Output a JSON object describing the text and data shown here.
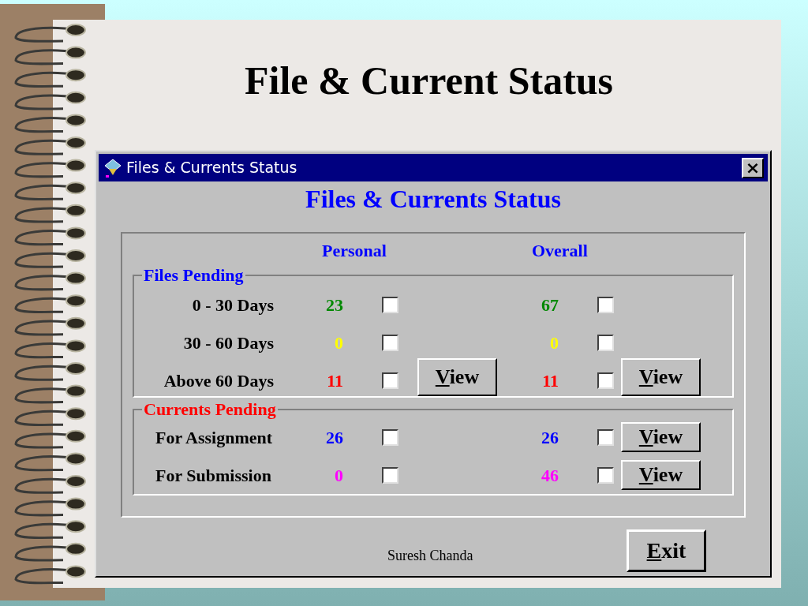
{
  "slide": {
    "title": "File & Current Status",
    "footer": "Suresh Chanda"
  },
  "window": {
    "title": "Files & Currents Status",
    "close": "×",
    "heading": "Files & Currents Status"
  },
  "columns": {
    "personal": "Personal",
    "overall": "Overall"
  },
  "files_pending": {
    "title": "Files Pending",
    "rows": [
      {
        "label": "0 - 30 Days",
        "personal": {
          "value": "23",
          "color": "#008800",
          "checked": false
        },
        "overall": {
          "value": "67",
          "color": "#008800",
          "checked": false
        }
      },
      {
        "label": "30 - 60 Days",
        "personal": {
          "value": "0",
          "color": "#ffff00",
          "checked": false
        },
        "overall": {
          "value": "0",
          "color": "#ffff00",
          "checked": false
        }
      },
      {
        "label": "Above 60 Days",
        "personal": {
          "value": "11",
          "color": "#ff0000",
          "checked": false
        },
        "overall": {
          "value": "11",
          "color": "#ff0000",
          "checked": false
        }
      }
    ],
    "personal_button": "View",
    "overall_button": "View"
  },
  "currents_pending": {
    "title": "Currents Pending",
    "rows": [
      {
        "label": "For Assignment",
        "personal": {
          "value": "26",
          "color": "#0000ff",
          "checked": false
        },
        "overall": {
          "value": "26",
          "color": "#0000ff",
          "checked": false
        },
        "button": "View"
      },
      {
        "label": "For Submission",
        "personal": {
          "value": "0",
          "color": "#ff00ff",
          "checked": false
        },
        "overall": {
          "value": "46",
          "color": "#ff00ff",
          "checked": false
        },
        "button": "View"
      }
    ]
  },
  "exit_button": "Exit"
}
